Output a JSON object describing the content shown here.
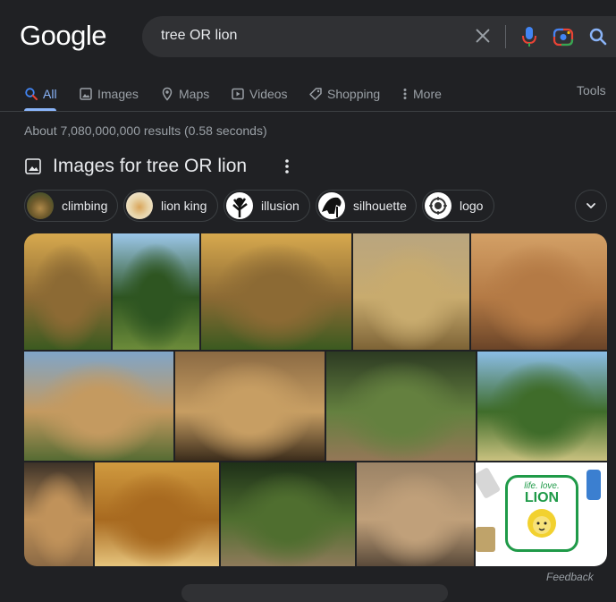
{
  "logo": "Google",
  "search": {
    "query": "tree OR lion"
  },
  "tabs": [
    {
      "label": "All",
      "icon": "search-icon",
      "active": true
    },
    {
      "label": "Images",
      "icon": "image-icon"
    },
    {
      "label": "Maps",
      "icon": "pin-icon"
    },
    {
      "label": "Videos",
      "icon": "play-icon"
    },
    {
      "label": "Shopping",
      "icon": "tag-icon"
    },
    {
      "label": "More",
      "icon": "more-vert-icon"
    }
  ],
  "tools_label": "Tools",
  "result_stats": "About 7,080,000,000 results (0.58 seconds)",
  "images_section": {
    "title": "Images for tree OR lion",
    "chips": [
      "climbing",
      "lion king",
      "illusion",
      "silhouette",
      "logo"
    ]
  },
  "image_tiles": [
    {
      "name": "lion cub",
      "colors": [
        "#d7a94e",
        "#8c6a34",
        "#3b5a20"
      ]
    },
    {
      "name": "tree in field",
      "colors": [
        "#9cc7ea",
        "#2e5521",
        "#6c8b3a"
      ]
    },
    {
      "name": "lion cub",
      "colors": [
        "#d7a94e",
        "#8c6a34",
        "#3b5a20"
      ]
    },
    {
      "name": "lion on savanna",
      "colors": [
        "#b9a57f",
        "#c8ab6e",
        "#7d6336"
      ]
    },
    {
      "name": "lions cuddling",
      "colors": [
        "#d3a066",
        "#b47a45",
        "#6a4428"
      ]
    },
    {
      "name": "lioness closeup",
      "colors": [
        "#7fa5c9",
        "#c49a60",
        "#556b33"
      ]
    },
    {
      "name": "lion face",
      "colors": [
        "#8b6a43",
        "#c79e63",
        "#3b2c1b"
      ]
    },
    {
      "name": "tree illusion",
      "colors": [
        "#2c3a22",
        "#64803f",
        "#947757"
      ]
    },
    {
      "name": "green tree",
      "colors": [
        "#8bbde6",
        "#3f6c2a",
        "#c9c17f"
      ]
    },
    {
      "name": "lions resting",
      "colors": [
        "#3d3228",
        "#c0925a",
        "#8c6a45"
      ]
    },
    {
      "name": "lion in grass",
      "colors": [
        "#d09a3f",
        "#a86a20",
        "#e6c47c"
      ]
    },
    {
      "name": "live oak tree",
      "colors": [
        "#1e3018",
        "#4f6e2f",
        "#8e7a5a"
      ]
    },
    {
      "name": "lion blur",
      "colors": [
        "#9b8366",
        "#c0a07a",
        "#5a4a3a"
      ]
    },
    {
      "name": "lion logo",
      "colors": [
        "#ffffff",
        "#22994c",
        "#f2d12f"
      ]
    }
  ],
  "logo_tile": {
    "line1": "life. love.",
    "line2": "LION"
  },
  "feedback": "Feedback"
}
